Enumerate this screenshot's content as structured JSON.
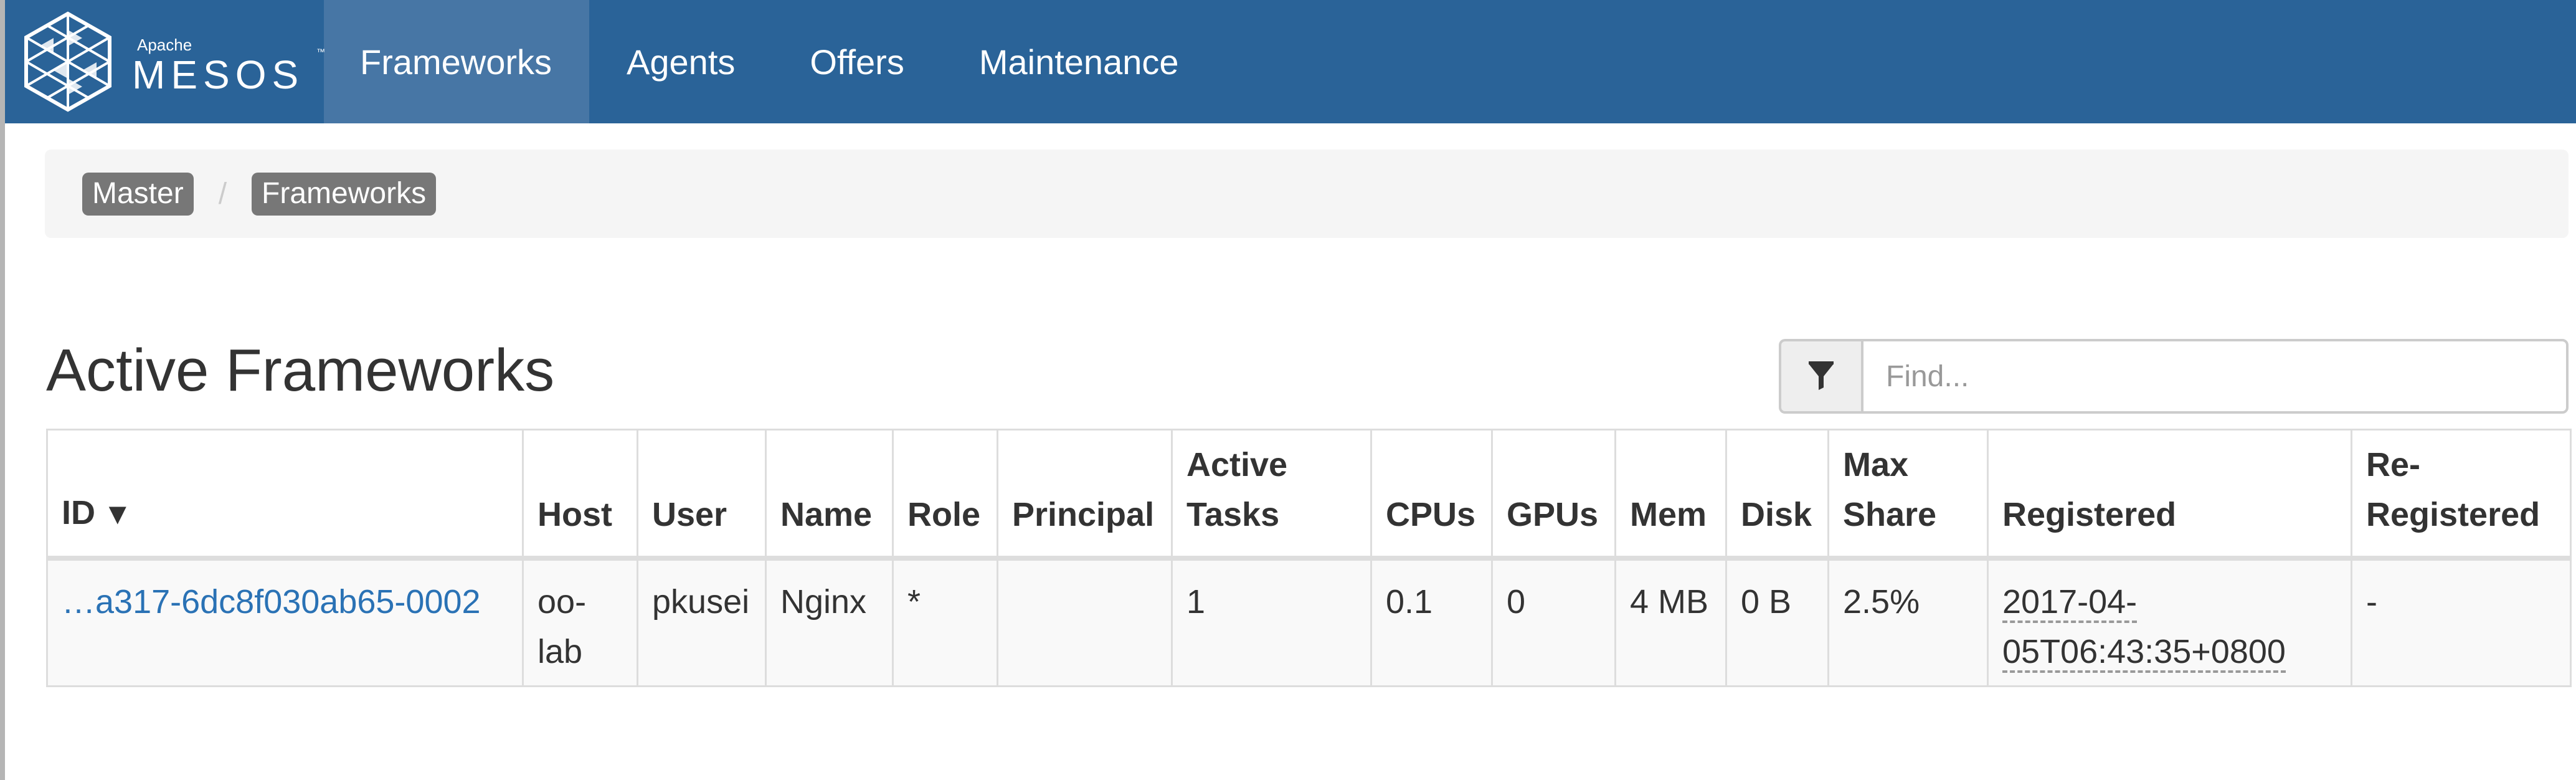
{
  "brand": {
    "small_label": "Apache",
    "name": "MESOS",
    "trademark": "™"
  },
  "nav": {
    "items": [
      {
        "label": "Frameworks",
        "active": true
      },
      {
        "label": "Agents",
        "active": false
      },
      {
        "label": "Offers",
        "active": false
      },
      {
        "label": "Maintenance",
        "active": false
      }
    ]
  },
  "breadcrumb": {
    "items": [
      "Master",
      "Frameworks"
    ],
    "separator": "/"
  },
  "page": {
    "title": "Active Frameworks"
  },
  "filter": {
    "icon": "filter-icon",
    "placeholder": "Find...",
    "value": ""
  },
  "table": {
    "sort_indicator": "▼",
    "columns": [
      {
        "key": "id",
        "label": "ID"
      },
      {
        "key": "host",
        "label": "Host"
      },
      {
        "key": "user",
        "label": "User"
      },
      {
        "key": "name",
        "label": "Name"
      },
      {
        "key": "role",
        "label": "Role"
      },
      {
        "key": "principal",
        "label": "Principal"
      },
      {
        "key": "active_tasks",
        "label": "Active Tasks"
      },
      {
        "key": "cpus",
        "label": "CPUs"
      },
      {
        "key": "gpus",
        "label": "GPUs"
      },
      {
        "key": "mem",
        "label": "Mem"
      },
      {
        "key": "disk",
        "label": "Disk"
      },
      {
        "key": "max_share",
        "label": "Max Share"
      },
      {
        "key": "registered",
        "label": "Registered"
      },
      {
        "key": "re_registered",
        "label": "Re-Registered"
      }
    ],
    "rows": [
      {
        "id": "…a317-6dc8f030ab65-0002",
        "host": "oo-lab",
        "user": "pkusei",
        "name": "Nginx",
        "role": "*",
        "principal": "",
        "active_tasks": "1",
        "cpus": "0.1",
        "gpus": "0",
        "mem": "4 MB",
        "disk": "0 B",
        "max_share": "2.5%",
        "registered": "2017-04-05T06:43:35+0800",
        "re_registered": "-"
      }
    ]
  },
  "colors": {
    "navbar": "#2a6398",
    "navbar_active": "#4776a5",
    "link": "#2a72b5",
    "crumb_badge": "#777777"
  }
}
